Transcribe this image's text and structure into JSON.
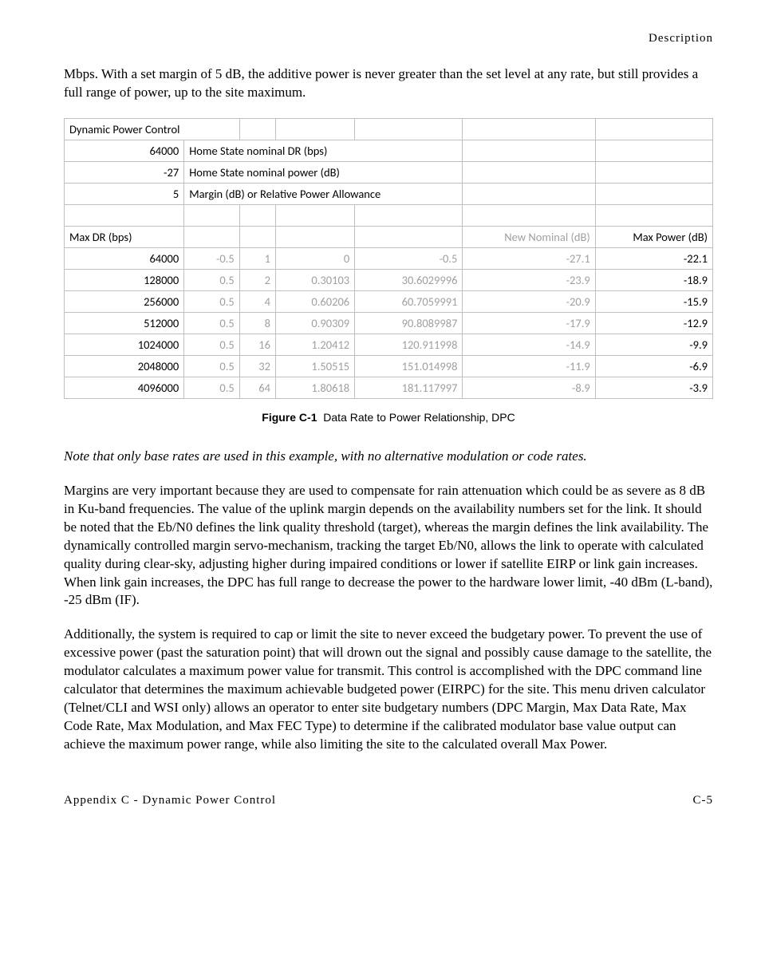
{
  "header": {
    "section_title": "Description"
  },
  "paragraphs": {
    "intro": "Mbps. With a set margin of 5 dB, the additive power is never greater than the set level at any rate, but still provides a full range of power, up to the site maximum.",
    "note": "Note that only base rates are used in this example, with no alternative modulation or code rates.",
    "margins": "Margins are very important because they are used to compensate for rain attenuation which could be as severe as 8 dB in Ku-band frequencies. The value of the uplink margin depends on the availability numbers set for the link. It should be noted that the Eb/N0 defines the link quality threshold (target), whereas the margin defines the link availability. The dynamically controlled margin servo-mechanism, tracking the target Eb/N0, allows the link to operate with calculated quality during clear-sky, adjusting higher during impaired conditions or lower if satellite EIRP or link gain increases. When link gain increases, the DPC has full range to decrease the power to the hardware lower limit, -40 dBm (L-band), -25 dBm (IF).",
    "additional": "Additionally, the system is required to cap or limit the site to never exceed the budgetary power. To prevent the use of excessive power (past the saturation point) that will drown out the signal and possibly cause damage to the satellite, the modulator calculates a maximum power value for transmit. This control is accomplished with the DPC command line calculator that determines the maximum achievable budgeted power (EIRPC) for the site. This menu driven calculator (Telnet/CLI and WSI only) allows an operator to enter site budgetary numbers (DPC Margin, Max Data Rate, Max Code Rate, Max Modulation, and Max FEC Type) to determine if the calibrated modulator base value output can achieve the maximum power range, while also limiting the site to the calculated overall Max Power."
  },
  "table": {
    "title_cell": "Dynamic Power Control",
    "param_rows": [
      {
        "value": "64000",
        "label": "Home State nominal DR (bps)"
      },
      {
        "value": "-27",
        "label": "Home State nominal power (dB)"
      },
      {
        "value": "5",
        "label": "Margin (dB) or Relative Power Allowance"
      }
    ],
    "headers": {
      "maxdr": "Max DR (bps)",
      "newnom": "New Nominal (dB)",
      "maxpow": "Max Power (dB)"
    },
    "rows": [
      {
        "dr": "64000",
        "c2": "-0.5",
        "c3": "1",
        "c4": "0",
        "c5": "-0.5",
        "nn": "-27.1",
        "mp": "-22.1"
      },
      {
        "dr": "128000",
        "c2": "0.5",
        "c3": "2",
        "c4": "0.30103",
        "c5": "30.6029996",
        "nn": "-23.9",
        "mp": "-18.9"
      },
      {
        "dr": "256000",
        "c2": "0.5",
        "c3": "4",
        "c4": "0.60206",
        "c5": "60.7059991",
        "nn": "-20.9",
        "mp": "-15.9"
      },
      {
        "dr": "512000",
        "c2": "0.5",
        "c3": "8",
        "c4": "0.90309",
        "c5": "90.8089987",
        "nn": "-17.9",
        "mp": "-12.9"
      },
      {
        "dr": "1024000",
        "c2": "0.5",
        "c3": "16",
        "c4": "1.20412",
        "c5": "120.911998",
        "nn": "-14.9",
        "mp": "-9.9"
      },
      {
        "dr": "2048000",
        "c2": "0.5",
        "c3": "32",
        "c4": "1.50515",
        "c5": "151.014998",
        "nn": "-11.9",
        "mp": "-6.9"
      },
      {
        "dr": "4096000",
        "c2": "0.5",
        "c3": "64",
        "c4": "1.80618",
        "c5": "181.117997",
        "nn": "-8.9",
        "mp": "-3.9"
      }
    ]
  },
  "figure": {
    "label": "Figure C-1",
    "caption": "Data Rate to Power Relationship, DPC"
  },
  "footer": {
    "left": "Appendix C - Dynamic Power Control",
    "right": "C-5"
  },
  "chart_data": {
    "type": "table",
    "title": "Dynamic Power Control — Data Rate to Power Relationship",
    "parameters": {
      "home_state_nominal_dr_bps": 64000,
      "home_state_nominal_power_db": -27,
      "margin_db_or_relative_power_allowance": 5
    },
    "columns": [
      "Max DR (bps)",
      "col2",
      "col3",
      "col4",
      "col5",
      "New Nominal (dB)",
      "Max Power (dB)"
    ],
    "rows": [
      [
        64000,
        -0.5,
        1,
        0,
        -0.5,
        -27.1,
        -22.1
      ],
      [
        128000,
        0.5,
        2,
        0.30103,
        30.6029996,
        -23.9,
        -18.9
      ],
      [
        256000,
        0.5,
        4,
        0.60206,
        60.7059991,
        -20.9,
        -15.9
      ],
      [
        512000,
        0.5,
        8,
        0.90309,
        90.8089987,
        -17.9,
        -12.9
      ],
      [
        1024000,
        0.5,
        16,
        1.20412,
        120.911998,
        -14.9,
        -9.9
      ],
      [
        2048000,
        0.5,
        32,
        1.50515,
        151.014998,
        -11.9,
        -6.9
      ],
      [
        4096000,
        0.5,
        64,
        1.80618,
        181.117997,
        -8.9,
        -3.9
      ]
    ]
  }
}
